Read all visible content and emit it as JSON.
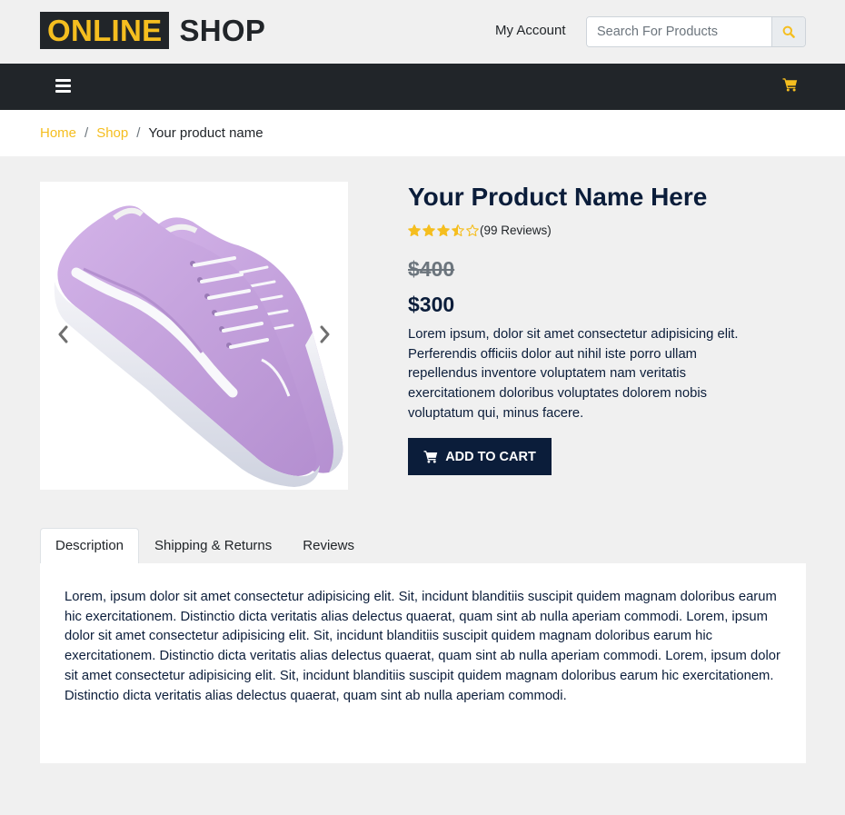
{
  "header": {
    "logo_part1": "ONLINE",
    "logo_part2": "SHOP",
    "my_account": "My Account",
    "search_placeholder": "Search For Products"
  },
  "breadcrumb": {
    "home": "Home",
    "shop": "Shop",
    "current": "Your product name",
    "separator": "/"
  },
  "product": {
    "title": "Your Product Name Here",
    "rating": 3.5,
    "max_rating": 5,
    "reviews_text": "(99 Reviews)",
    "old_price": "$400",
    "new_price": "$300",
    "description": "Lorem ipsum, dolor sit amet consectetur adipisicing elit. Perferendis officiis dolor aut nihil iste porro ullam repellendus inventore voluptatem nam veritatis exercitationem doloribus voluptates dolorem nobis voluptatum qui, minus facere.",
    "add_to_cart": "ADD TO CART",
    "image_alt": "lavender canvas sneakers"
  },
  "tabs": [
    {
      "label": "Description",
      "active": true
    },
    {
      "label": "Shipping & Returns",
      "active": false
    },
    {
      "label": "Reviews",
      "active": false
    }
  ],
  "tab_content": "Lorem, ipsum dolor sit amet consectetur adipisicing elit. Sit, incidunt blanditiis suscipit quidem magnam doloribus earum hic exercitationem. Distinctio dicta veritatis alias delectus quaerat, quam sint ab nulla aperiam commodi. Lorem, ipsum dolor sit amet consectetur adipisicing elit. Sit, incidunt blanditiis suscipit quidem magnam doloribus earum hic exercitationem. Distinctio dicta veritatis alias delectus quaerat, quam sint ab nulla aperiam commodi. Lorem, ipsum dolor sit amet consectetur adipisicing elit. Sit, incidunt blanditiis suscipit quidem magnam doloribus earum hic exercitationem. Distinctio dicta veritatis alias delectus quaerat, quam sint ab nulla aperiam commodi.",
  "colors": {
    "accent": "#f5be1f",
    "dark": "#212529",
    "navy": "#0b1d3a",
    "background": "#f0f0f0"
  },
  "icons": {
    "search": "search-icon",
    "menu": "hamburger-menu-icon",
    "cart": "cart-icon",
    "prev": "chevron-left-icon",
    "next": "chevron-right-icon",
    "star": "star-icon"
  }
}
